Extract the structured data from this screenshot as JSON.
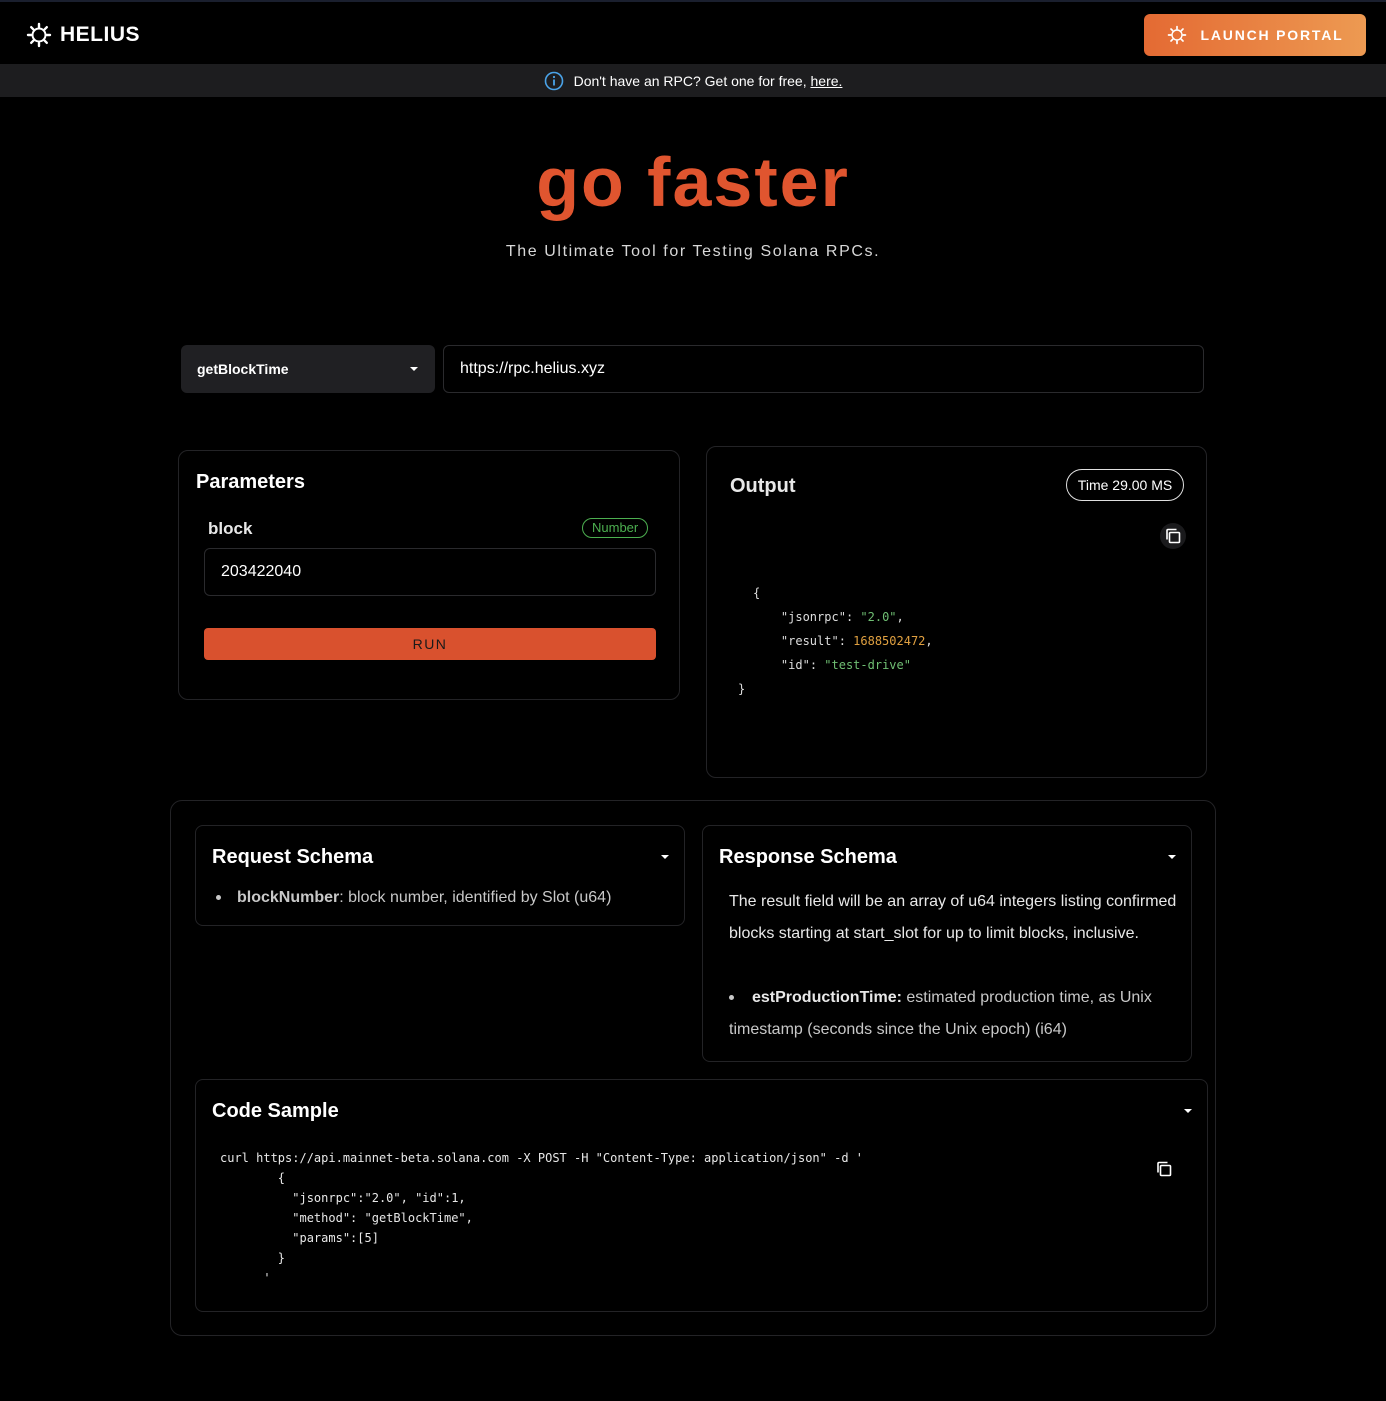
{
  "header": {
    "logo_text": "HELIUS",
    "launch_label": "LAUNCH PORTAL",
    "accent": "#e0552f"
  },
  "notice": {
    "text": "Don't have an RPC? Get one for free,",
    "link": "here."
  },
  "hero": {
    "title": "go faster",
    "subtitle": "The Ultimate Tool for Testing Solana RPCs."
  },
  "controls": {
    "method": "getBlockTime",
    "url": "https://rpc.helius.xyz"
  },
  "parameters": {
    "title": "Parameters",
    "param_name": "block",
    "param_type": "Number",
    "param_value": "203422040",
    "run_label": "RUN"
  },
  "output": {
    "title": "Output",
    "time": "Time 29.00 MS",
    "json_open": "{",
    "jsonrpc_key": "\"jsonrpc\"",
    "jsonrpc_val": "\"2.0\"",
    "result_key": "\"result\"",
    "result_val": "1688502472",
    "id_key": "\"id\"",
    "id_val": "\"test-drive\"",
    "json_close": "}"
  },
  "request_schema": {
    "title": "Request Schema",
    "field_name": "blockNumber",
    "field_desc": ": block number, identified by Slot (u64)"
  },
  "response_schema": {
    "title": "Response Schema",
    "description": "The result field will be an array of u64 integers listing confirmed blocks starting at start_slot for up to limit blocks, inclusive.",
    "field_name": "estProductionTime:",
    "field_desc": " estimated production time, as Unix timestamp (seconds since the Unix epoch) (i64)"
  },
  "code_sample": {
    "title": "Code Sample",
    "code": "curl https://api.mainnet-beta.solana.com -X POST -H \"Content-Type: application/json\" -d '\n        {\n          \"jsonrpc\":\"2.0\", \"id\":1,\n          \"method\": \"getBlockTime\",\n          \"params\":[5]\n        }\n      '"
  },
  "icons": {
    "logo": "helius-logo-icon",
    "info": "info-icon",
    "copy": "copy-icon",
    "caret": "chevron-down-icon"
  }
}
